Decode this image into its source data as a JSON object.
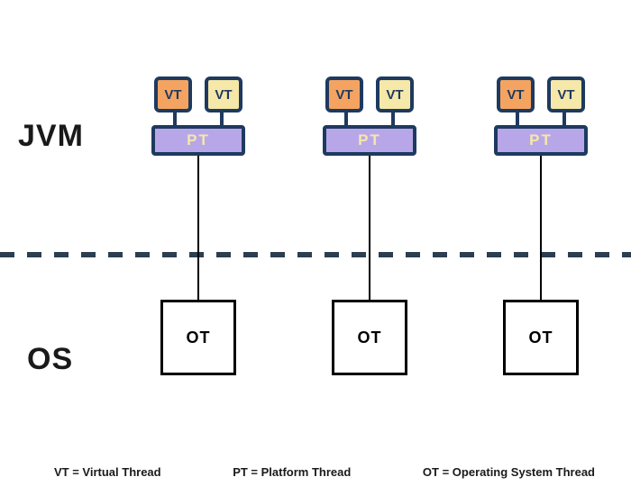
{
  "layers": {
    "jvm_label": "JVM",
    "os_label": "OS"
  },
  "boxes": {
    "vt": "VT",
    "pt": "PT",
    "ot": "OT"
  },
  "legend": {
    "vt": "VT = Virtual Thread",
    "pt": "PT = Platform Thread",
    "ot": "OT = Operating System Thread"
  },
  "colors": {
    "border_navy": "#1e3a5f",
    "vt_orange": "#f4a460",
    "vt_yellow": "#f5e8a8",
    "pt_fill": "#b8a7e8",
    "dash": "#2c3e50"
  },
  "chart_data": {
    "type": "diagram",
    "title": "JVM Virtual Threads to OS Threads mapping",
    "columns": 3,
    "per_column": {
      "virtual_threads": 2,
      "platform_threads": 1,
      "os_threads": 1
    },
    "boundary": "Dashed line separates JVM (VT, PT) from OS (OT)",
    "mapping": "Two VT mount onto one PT; one PT maps 1:1 to one OT"
  }
}
